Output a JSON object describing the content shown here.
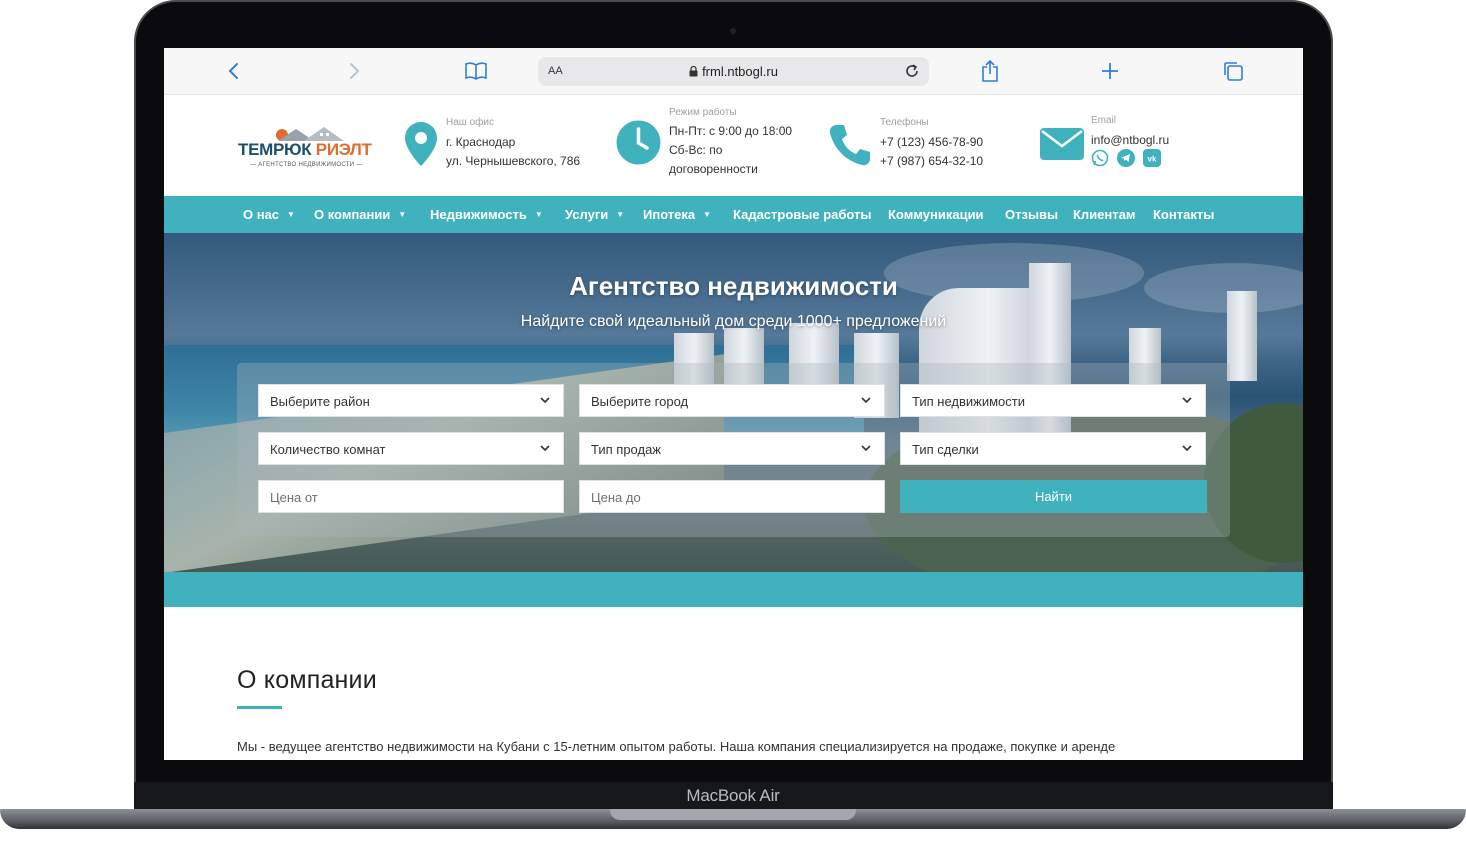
{
  "device": {
    "model_label": "MacBook Air"
  },
  "browser": {
    "address_aa": "AA",
    "url": "frml.ntbogl.ru",
    "icons": [
      "back-icon",
      "forward-icon",
      "bookmarks-icon",
      "lock-icon",
      "reload-icon",
      "share-icon",
      "new-tab-icon",
      "tabs-icon"
    ]
  },
  "header": {
    "logo": {
      "word1": "ТЕМРЮК",
      "word2": "РИЭЛТ",
      "tagline": "АГЕНТСТВО НЕДВИЖИМОСТИ"
    },
    "office": {
      "caption": "Наш офис",
      "line1": "г. Краснодар",
      "line2": "ул. Чернышевского, 786"
    },
    "hours": {
      "caption": "Режим работы",
      "line1": "Пн-Пт: с 9:00 до 18:00",
      "line2": "Сб-Вс: по",
      "line3": "договоренности"
    },
    "phones": {
      "caption": "Телефоны",
      "line1": "+7 (123) 456-78-90",
      "line2": "+7 (987) 654-32-10"
    },
    "email": {
      "caption": "Email",
      "address": "info@ntbogl.ru",
      "social_icons": [
        "whatsapp-icon",
        "telegram-icon",
        "vk-icon"
      ]
    }
  },
  "nav": {
    "items": [
      {
        "label": "О нас",
        "dropdown": true
      },
      {
        "label": "О компании",
        "dropdown": true
      },
      {
        "label": "Недвижимость",
        "dropdown": true
      },
      {
        "label": "Услуги",
        "dropdown": true
      },
      {
        "label": "Ипотека",
        "dropdown": true
      },
      {
        "label": "Кадастровые работы",
        "dropdown": false
      },
      {
        "label": "Коммуникации",
        "dropdown": false
      },
      {
        "label": "Отзывы",
        "dropdown": false
      },
      {
        "label": "Клиентам",
        "dropdown": false
      },
      {
        "label": "Контакты",
        "dropdown": false
      }
    ]
  },
  "hero": {
    "title": "Агентство недвижимости",
    "subtitle": "Найдите свой идеальный дом среди 1000+ предложений"
  },
  "search": {
    "district": "Выберите район",
    "city": "Выберите город",
    "property_type": "Тип недвижимости",
    "rooms": "Количество комнат",
    "sale_type": "Тип продаж",
    "deal_type": "Тип сделки",
    "price_from_placeholder": "Цена от",
    "price_to_placeholder": "Цена до",
    "submit_label": "Найти"
  },
  "about": {
    "title": "О компании",
    "text": "Мы - ведущее агентство недвижимости на Кубани с 15-летним опытом работы. Наша компания специализируется на продаже, покупке и аренде"
  },
  "colors": {
    "accent": "#3fb2bd",
    "logo_blue": "#1d4f6b",
    "logo_orange": "#e06b2f"
  }
}
